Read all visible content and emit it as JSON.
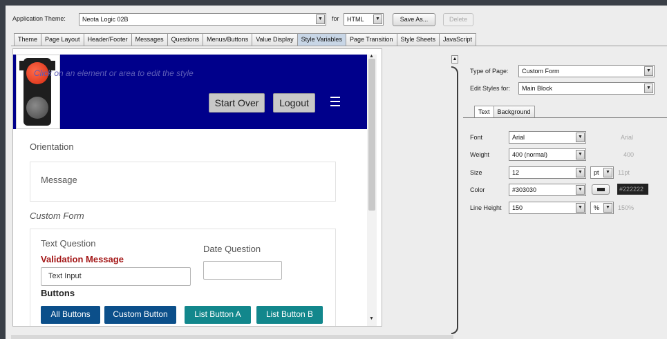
{
  "topbar": {
    "theme_label": "Application Theme:",
    "theme_value": "Neota Logic 02B",
    "for_label": "for",
    "format_value": "HTML",
    "save_as_label": "Save As...",
    "delete_label": "Delete"
  },
  "tabs": [
    {
      "label": "Theme"
    },
    {
      "label": "Page Layout"
    },
    {
      "label": "Header/Footer"
    },
    {
      "label": "Messages"
    },
    {
      "label": "Questions"
    },
    {
      "label": "Menus/Buttons"
    },
    {
      "label": "Value Display"
    },
    {
      "label": "Style Variables",
      "active": true
    },
    {
      "label": "Page Transition"
    },
    {
      "label": "Style Sheets"
    },
    {
      "label": "JavaScript"
    }
  ],
  "preview": {
    "hint": "Click on an element or area to edit the style",
    "start_over": "Start Over",
    "logout": "Logout",
    "orientation": "Orientation",
    "message": "Message",
    "custom_form": "Custom Form",
    "text_question": "Text Question",
    "validation_message": "Validation Message",
    "text_input": "Text Input",
    "date_question": "Date Question",
    "buttons_label": "Buttons",
    "buttons": [
      {
        "label": "All Buttons",
        "color": "#0b4f8a"
      },
      {
        "label": "Custom Button",
        "color": "#0b4f8a"
      },
      {
        "label": "List Button A",
        "color": "#12878c"
      },
      {
        "label": "List Button B",
        "color": "#12878c"
      }
    ],
    "header_color": "#00008b"
  },
  "style_panel": {
    "type_of_page_label": "Type of Page:",
    "type_of_page_value": "Custom Form",
    "edit_styles_label": "Edit Styles for:",
    "edit_styles_value": "Main Block",
    "tab_text": "Text",
    "tab_background": "Background",
    "font_label": "Font",
    "font_value": "Arial",
    "font_default": "Arial",
    "weight_label": "Weight",
    "weight_value": "400 (normal)",
    "weight_default": "400",
    "size_label": "Size",
    "size_value": "12",
    "size_unit": "pt",
    "size_default": "11pt",
    "color_label": "Color",
    "color_value": "#303030",
    "color_default": "#222222",
    "line_height_label": "Line Height",
    "line_height_value": "150",
    "line_height_unit": "%",
    "line_height_default": "150%"
  }
}
